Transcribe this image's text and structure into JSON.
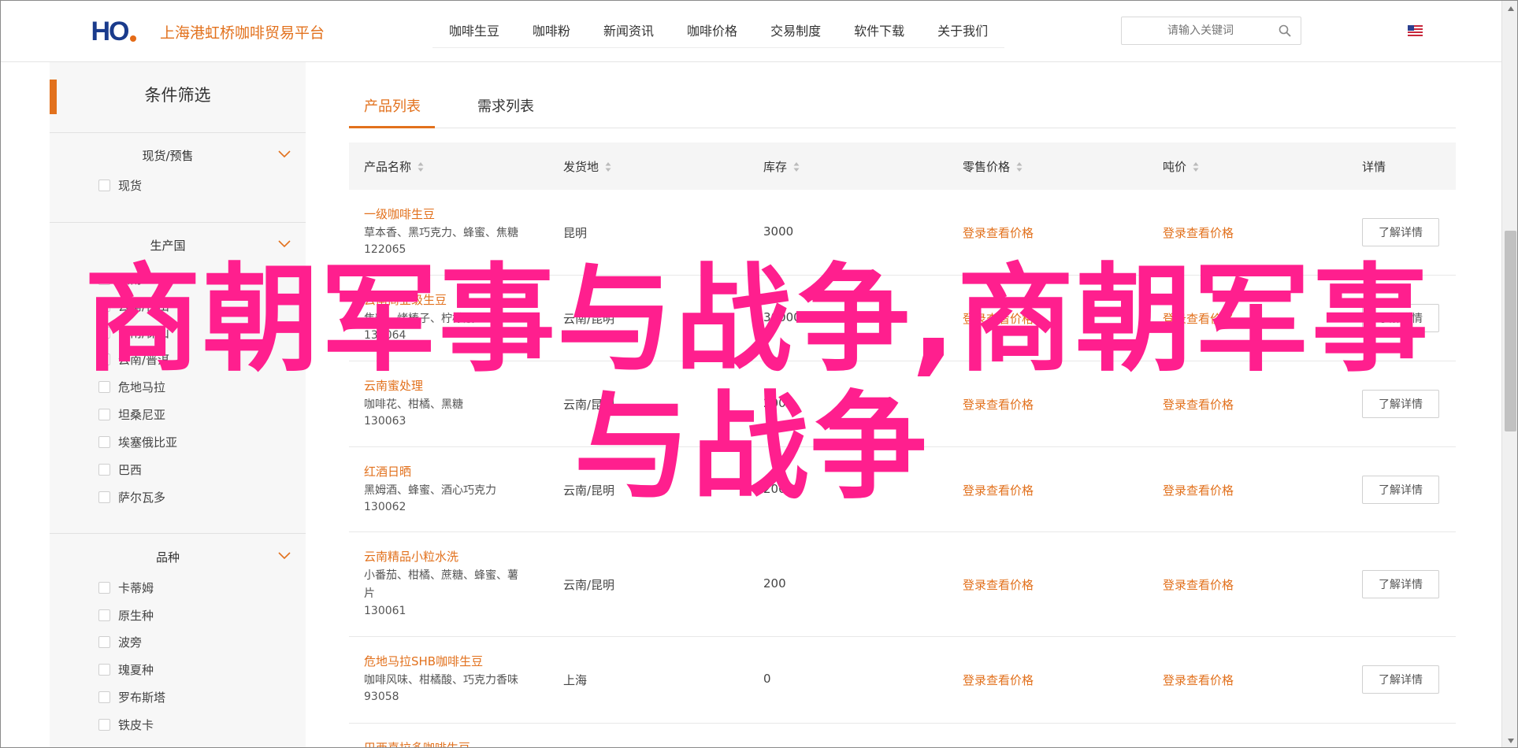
{
  "header": {
    "logo_text": "HO",
    "site_name": "上海港虹桥咖啡贸易平台",
    "nav": [
      "咖啡生豆",
      "咖啡粉",
      "新闻资讯",
      "咖啡价格",
      "交易制度",
      "软件下载",
      "关于我们"
    ],
    "search_placeholder": "请输入关键词",
    "search_icon": "search-icon",
    "flag_icon": "us-flag-icon"
  },
  "sidebar": {
    "title": "条件筛选",
    "groups": [
      {
        "title": "现货/预售",
        "options": [
          "现货"
        ]
      },
      {
        "title": "生产国",
        "options": [
          "云南",
          "云南/保山",
          "云南/保山",
          "云南/普洱",
          "危地马拉",
          "坦桑尼亚",
          "埃塞俄比亚",
          "巴西",
          "萨尔瓦多"
        ]
      },
      {
        "title": "品种",
        "options": [
          "卡蒂姆",
          "原生种",
          "波旁",
          "瑰夏种",
          "罗布斯塔",
          "铁皮卡"
        ]
      }
    ]
  },
  "tabs": [
    "产品列表",
    "需求列表"
  ],
  "table": {
    "columns": [
      "产品名称",
      "发货地",
      "库存",
      "零售价格",
      "吨价",
      "详情"
    ],
    "price_text": "登录查看价格",
    "detail_label": "了解详情",
    "rows": [
      {
        "name": "一级咖啡生豆",
        "desc": [
          "草本香、黑巧克力、蜂蜜、焦糖"
        ],
        "id": "122065",
        "origin": "昆明",
        "stock": "3000"
      },
      {
        "name": "云南商业级生豆",
        "desc": [
          "焦糖、烤榛子、柠檬酸"
        ],
        "id": "130064",
        "origin": "云南/昆明",
        "stock": "30000"
      },
      {
        "name": "云南蜜处理",
        "desc": [
          "咖啡花、柑橘、黑糖"
        ],
        "id": "130063",
        "origin": "云南/昆明",
        "stock": "200"
      },
      {
        "name": "红酒日晒",
        "desc": [
          "黑姆酒、蜂蜜、酒心巧克力"
        ],
        "id": "130062",
        "origin": "云南/昆明",
        "stock": "200"
      },
      {
        "name": "云南精品小粒水洗",
        "desc": [
          "小番茄、柑橘、蔗糖、蜂蜜、薯",
          "片"
        ],
        "id": "130061",
        "origin": "云南/昆明",
        "stock": "200"
      },
      {
        "name": "危地马拉SHB咖啡生豆",
        "desc": [
          "咖啡风味、柑橘酸、巧克力香味"
        ],
        "id": "93058",
        "origin": "上海",
        "stock": "0"
      },
      {
        "name": "巴西喜拉多咖啡生豆",
        "desc": [],
        "id": "",
        "origin": "",
        "stock": ""
      }
    ]
  },
  "overlay": {
    "line1": "商朝军事与战争,商朝军事",
    "line2": "与战争",
    "color": "#ff1f8e"
  },
  "colors": {
    "accent": "#e2711d",
    "brand_blue": "#1a3b8c"
  }
}
